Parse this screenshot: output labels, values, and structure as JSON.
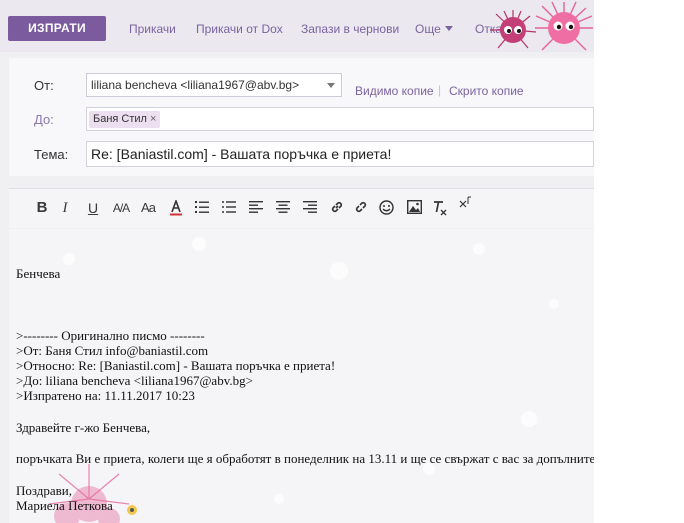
{
  "toolbar": {
    "send_label": "ИЗПРАТИ",
    "attach_label": "Прикачи",
    "attach_dox_label": "Прикачи от Dox",
    "save_draft_label": "Запази в чернови",
    "more_label": "Още",
    "cancel_label": "Отказ"
  },
  "fields": {
    "from_label": "От:",
    "from_value": "liliana bencheva <liliana1967@abv.bg>",
    "cc_label": "Видимо копие",
    "bcc_label": "Скрито копие",
    "to_label": "До:",
    "to_chip": "Баня Стил",
    "to_chip_remove": "×",
    "subject_label": "Тема:",
    "subject_value": "Re: [Baniastil.com] - Вашата поръчка е приета!"
  },
  "editor_toolbar": [
    {
      "name": "bold-button",
      "icon": "bold-icon"
    },
    {
      "name": "italic-button",
      "icon": "italic-icon"
    },
    {
      "name": "underline-button",
      "icon": "underline-icon"
    },
    {
      "name": "font-size-button",
      "icon": "font-size-icon"
    },
    {
      "name": "font-family-button",
      "icon": "font-family-icon"
    },
    {
      "name": "text-color-button",
      "icon": "text-color-icon"
    },
    {
      "name": "numbered-list-button",
      "icon": "numbered-list-icon"
    },
    {
      "name": "bullet-list-button",
      "icon": "bullet-list-icon"
    },
    {
      "name": "align-left-button",
      "icon": "align-left-icon"
    },
    {
      "name": "align-center-button",
      "icon": "align-center-icon"
    },
    {
      "name": "align-right-button",
      "icon": "align-right-icon"
    },
    {
      "name": "insert-link-button",
      "icon": "link-icon"
    },
    {
      "name": "remove-link-button",
      "icon": "unlink-icon"
    },
    {
      "name": "emoji-button",
      "icon": "smiley-icon"
    },
    {
      "name": "insert-image-button",
      "icon": "image-icon"
    },
    {
      "name": "clear-format-button",
      "icon": "clear-format-icon"
    },
    {
      "name": "close-editor-button",
      "icon": "close-icon"
    }
  ],
  "body": {
    "lines": [
      "Бенчева",
      ">-------- Оригинално писмо --------",
      ">От: Баня Стил info@baniastil.com",
      ">Относно: Re: [Baniastil.com] - Вашата поръчка е приета!",
      ">До: liliana bencheva <liliana1967@abv.bg>",
      ">Изпратено на: 11.11.2017 10:23",
      "Здравейте г-жо Бенчева,",
      " поръчката Ви е приета, колеги ще я обработят в понеделник на 13.11 и ще се свържат с вас за допълнително уточнение",
      "Поздрави,",
      "Мариела Петкова"
    ]
  },
  "colors": {
    "accent": "#7b5a9e",
    "link": "#7a64a0",
    "chip_bg": "#ecdff0",
    "decoration_pink": "#e0608c"
  }
}
